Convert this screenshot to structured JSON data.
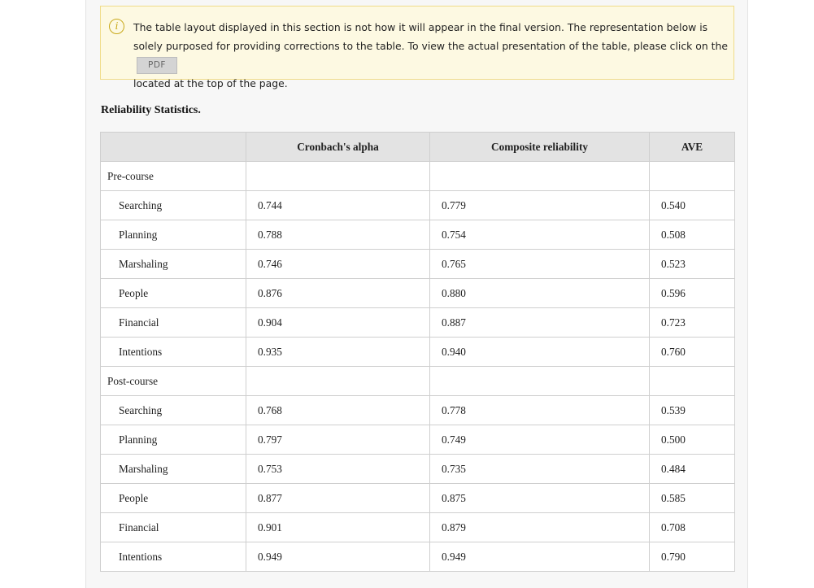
{
  "notice": {
    "text": "The table layout displayed in this section is not how it will appear in the final version. The representation below is solely purposed for providing corrections to the table. To view the actual presentation of the table, please click on the",
    "pdf_label": "PDF",
    "text_after": "located at the top of the page.",
    "icon": "info-icon"
  },
  "table": {
    "title": "Reliability Statistics.",
    "headers": [
      "",
      "Cronbach's alpha",
      "Composite reliability",
      "AVE"
    ],
    "groups": [
      {
        "label": "Pre-course",
        "rows": [
          {
            "name": "Searching",
            "alpha": "0.744",
            "cr": "0.779",
            "ave": "0.540"
          },
          {
            "name": "Planning",
            "alpha": "0.788",
            "cr": "0.754",
            "ave": "0.508"
          },
          {
            "name": "Marshaling",
            "alpha": "0.746",
            "cr": "0.765",
            "ave": "0.523"
          },
          {
            "name": "People",
            "alpha": "0.876",
            "cr": "0.880",
            "ave": "0.596"
          },
          {
            "name": "Financial",
            "alpha": "0.904",
            "cr": "0.887",
            "ave": "0.723"
          },
          {
            "name": "Intentions",
            "alpha": "0.935",
            "cr": "0.940",
            "ave": "0.760"
          }
        ]
      },
      {
        "label": "Post-course",
        "rows": [
          {
            "name": "Searching",
            "alpha": "0.768",
            "cr": "0.778",
            "ave": "0.539"
          },
          {
            "name": "Planning",
            "alpha": "0.797",
            "cr": "0.749",
            "ave": "0.500"
          },
          {
            "name": "Marshaling",
            "alpha": "0.753",
            "cr": "0.735",
            "ave": "0.484"
          },
          {
            "name": "People",
            "alpha": "0.877",
            "cr": "0.875",
            "ave": "0.585"
          },
          {
            "name": "Financial",
            "alpha": "0.901",
            "cr": "0.879",
            "ave": "0.708"
          },
          {
            "name": "Intentions",
            "alpha": "0.949",
            "cr": "0.949",
            "ave": "0.790"
          }
        ]
      }
    ]
  }
}
